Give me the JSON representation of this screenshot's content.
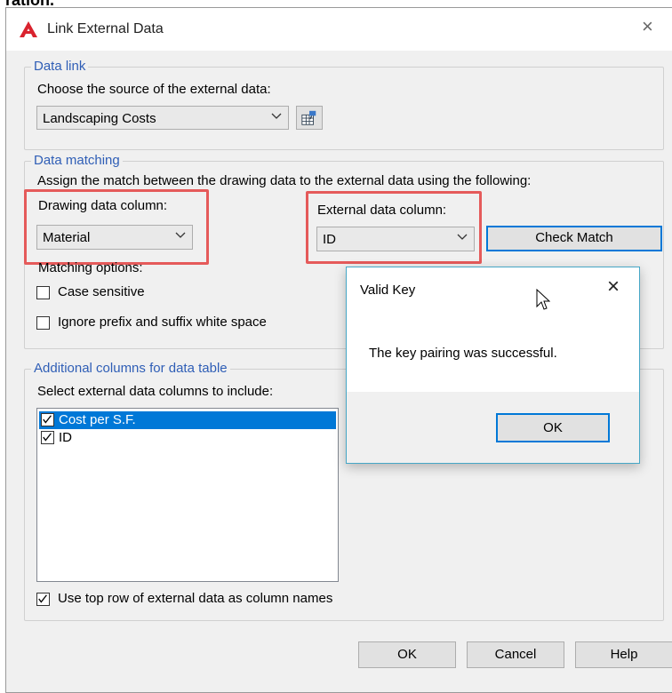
{
  "cropped_top_text": "ration.",
  "window": {
    "title": "Link External Data",
    "close_glyph": "×"
  },
  "data_link": {
    "legend": "Data link",
    "prompt": "Choose the source of the external data:",
    "source_value": "Landscaping Costs"
  },
  "data_matching": {
    "legend": "Data matching",
    "prompt": "Assign the match between the drawing data to the external data using the following:",
    "drawing_column_label": "Drawing data column:",
    "drawing_column_value": "Material",
    "external_column_label": "External data column:",
    "external_column_value": "ID",
    "check_match_label": "Check Match",
    "matching_options_label": "Matching options:",
    "case_sensitive_label": "Case sensitive",
    "case_sensitive_checked": false,
    "ignore_whitespace_label": "Ignore prefix and suffix white space",
    "ignore_whitespace_checked": false
  },
  "additional_columns": {
    "legend": "Additional columns for data table",
    "prompt": "Select external data columns to include:",
    "items": [
      {
        "label": "Cost per S.F.",
        "checked": true,
        "selected": true
      },
      {
        "label": "ID",
        "checked": true,
        "selected": false
      }
    ],
    "use_top_row_label": "Use top row of external data as column names",
    "use_top_row_checked": true
  },
  "footer": {
    "ok_label": "OK",
    "cancel_label": "Cancel",
    "help_label": "Help"
  },
  "popup": {
    "title": "Valid Key",
    "message": "The key pairing was successful.",
    "ok_label": "OK",
    "close_glyph": "×"
  },
  "colors": {
    "accent": "#0078d7",
    "group_label": "#2f5eb6",
    "highlight": "#e55a5a",
    "popup_border": "#46a7c6"
  }
}
